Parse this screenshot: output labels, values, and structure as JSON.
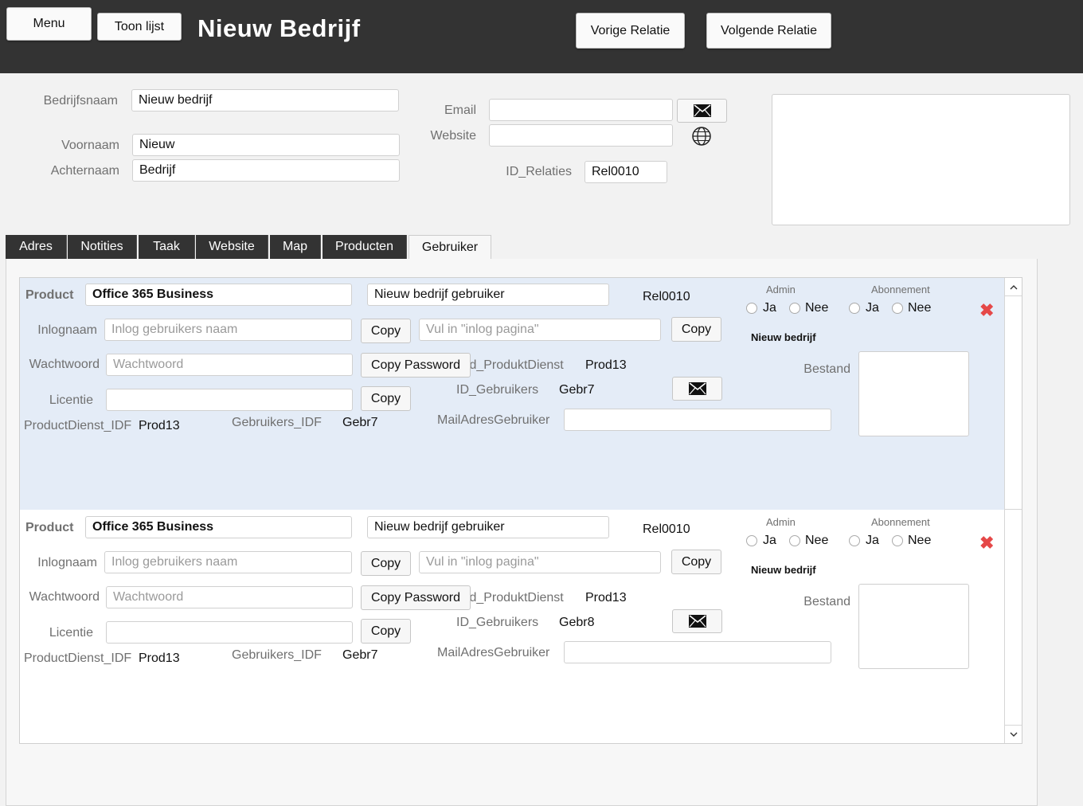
{
  "header": {
    "menu_label": "Menu",
    "list_label": "Toon lijst",
    "title": "Nieuw Bedrijf",
    "prev_label": "Vorige Relatie",
    "next_label": "Volgende Relatie"
  },
  "form": {
    "bedrijfsnaam_label": "Bedrijfsnaam",
    "bedrijfsnaam_value": "Nieuw bedrijf",
    "voornaam_label": "Voornaam",
    "voornaam_value": "Nieuw",
    "achternaam_label": "Achternaam",
    "achternaam_value": "Bedrijf",
    "email_label": "Email",
    "website_label": "Website",
    "id_label": "ID_Relaties",
    "id_value": "Rel0010"
  },
  "tabs": [
    "Adres",
    "Notities",
    "Taak",
    "Website",
    "Map",
    "Producten",
    "Gebruiker"
  ],
  "records": [
    {
      "product_label": "Product",
      "product_value": "Office 365 Business",
      "company_user": "Nieuw bedrijf gebruiker",
      "rel_id": "Rel0010",
      "admin_label": "Admin",
      "abonnement_label": "Abonnement",
      "ja": "Ja",
      "nee": "Nee",
      "company_name": "Nieuw bedrijf",
      "inlognaam_label": "Inlognaam",
      "inlognaam_placeholder": "Inlog gebruikers naam",
      "copy_label": "Copy",
      "url_placeholder": "Vul in \"inlog pagina\"",
      "wachtwoord_label": "Wachtwoord",
      "wachtwoord_placeholder": "Wachtwoord",
      "copy_password_label": "Copy Password",
      "id_produkt_label": "Id_ProduktDienst",
      "id_produkt_value": "Prod13",
      "licentie_label": "Licentie",
      "id_gebruikers_label": "ID_Gebruikers",
      "id_gebruikers_value": "Gebr7",
      "bestand_label": "Bestand",
      "mailadres_label": "MailAdresGebruiker",
      "productdienst_idf_label": "ProductDienst_IDF",
      "productdienst_idf_value": "Prod13",
      "gebruikers_idf_label": "Gebruikers_IDF",
      "gebruikers_idf_value": "Gebr7"
    },
    {
      "product_label": "Product",
      "product_value": "Office 365 Business",
      "company_user": "Nieuw bedrijf gebruiker",
      "rel_id": "Rel0010",
      "admin_label": "Admin",
      "abonnement_label": "Abonnement",
      "ja": "Ja",
      "nee": "Nee",
      "company_name": "Nieuw bedrijf",
      "inlognaam_label": "Inlognaam",
      "inlognaam_placeholder": "Inlog gebruikers naam",
      "copy_label": "Copy",
      "url_placeholder": "Vul in \"inlog pagina\"",
      "wachtwoord_label": "Wachtwoord",
      "wachtwoord_placeholder": "Wachtwoord",
      "copy_password_label": "Copy Password",
      "id_produkt_label": "Id_ProduktDienst",
      "id_produkt_value": "Prod13",
      "licentie_label": "Licentie",
      "id_gebruikers_label": "ID_Gebruikers",
      "id_gebruikers_value": "Gebr8",
      "bestand_label": "Bestand",
      "mailadres_label": "MailAdresGebruiker",
      "productdienst_idf_label": "ProductDienst_IDF",
      "productdienst_idf_value": "Prod13",
      "gebruikers_idf_label": "Gebruikers_IDF",
      "gebruikers_idf_value": "Gebr7"
    }
  ],
  "colors": {
    "header_bg": "#333333",
    "selected_row_bg": "#e4ecf7",
    "delete_red": "#e54848"
  },
  "icons": {
    "email": "envelope-icon",
    "website": "globe-icon",
    "delete": "delete-x-icon",
    "scroll_up": "chevron-up-icon",
    "scroll_down": "chevron-down-icon"
  }
}
